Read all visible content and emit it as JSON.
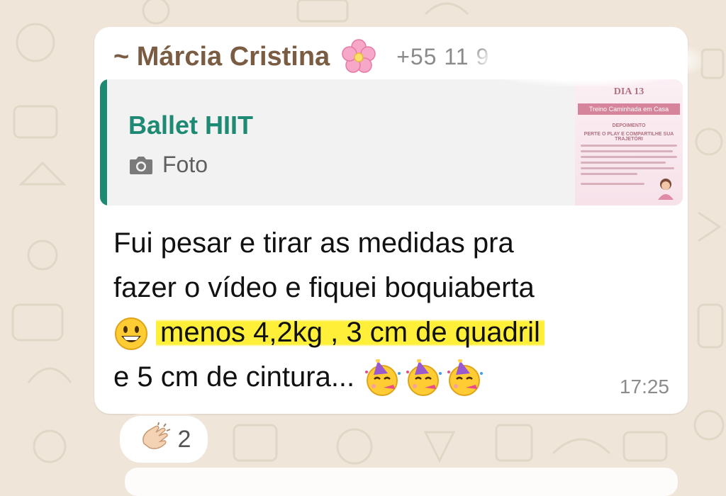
{
  "message": {
    "sender_name": "~ Márcia Cristina",
    "sender_emoji": "pink-flower",
    "sender_phone": "+55 11 9",
    "quoted": {
      "title": "Ballet HIIT",
      "media_label": "Foto",
      "media_icon": "camera-icon",
      "thumbnail": {
        "day": "DIA 13",
        "band": "Treino Caminhada em Casa",
        "section": "DEPOIMENTO",
        "subtitle": "PERTE O PLAY E COMPARTILHE SUA TRAJETÓRI"
      }
    },
    "text": {
      "line1": "Fui pesar e tirar as medidas pra",
      "line2": "fazer o vídeo e fiquei boquiaberta",
      "line3_emoji": "grinning-face",
      "line3_highlighted": "menos 4,2kg , 3 cm de quadril",
      "line4": "e 5 cm de cintura...",
      "line4_emojis": [
        "partying-face",
        "partying-face",
        "partying-face"
      ]
    },
    "time": "17:25",
    "reaction": {
      "emoji": "clapping-hands",
      "count": "2"
    }
  },
  "colors": {
    "background": "#efe6d9",
    "bubble": "#ffffff",
    "sender": "#7a5c43",
    "quote_accent": "#1f8a73",
    "highlight": "#ffee28"
  }
}
